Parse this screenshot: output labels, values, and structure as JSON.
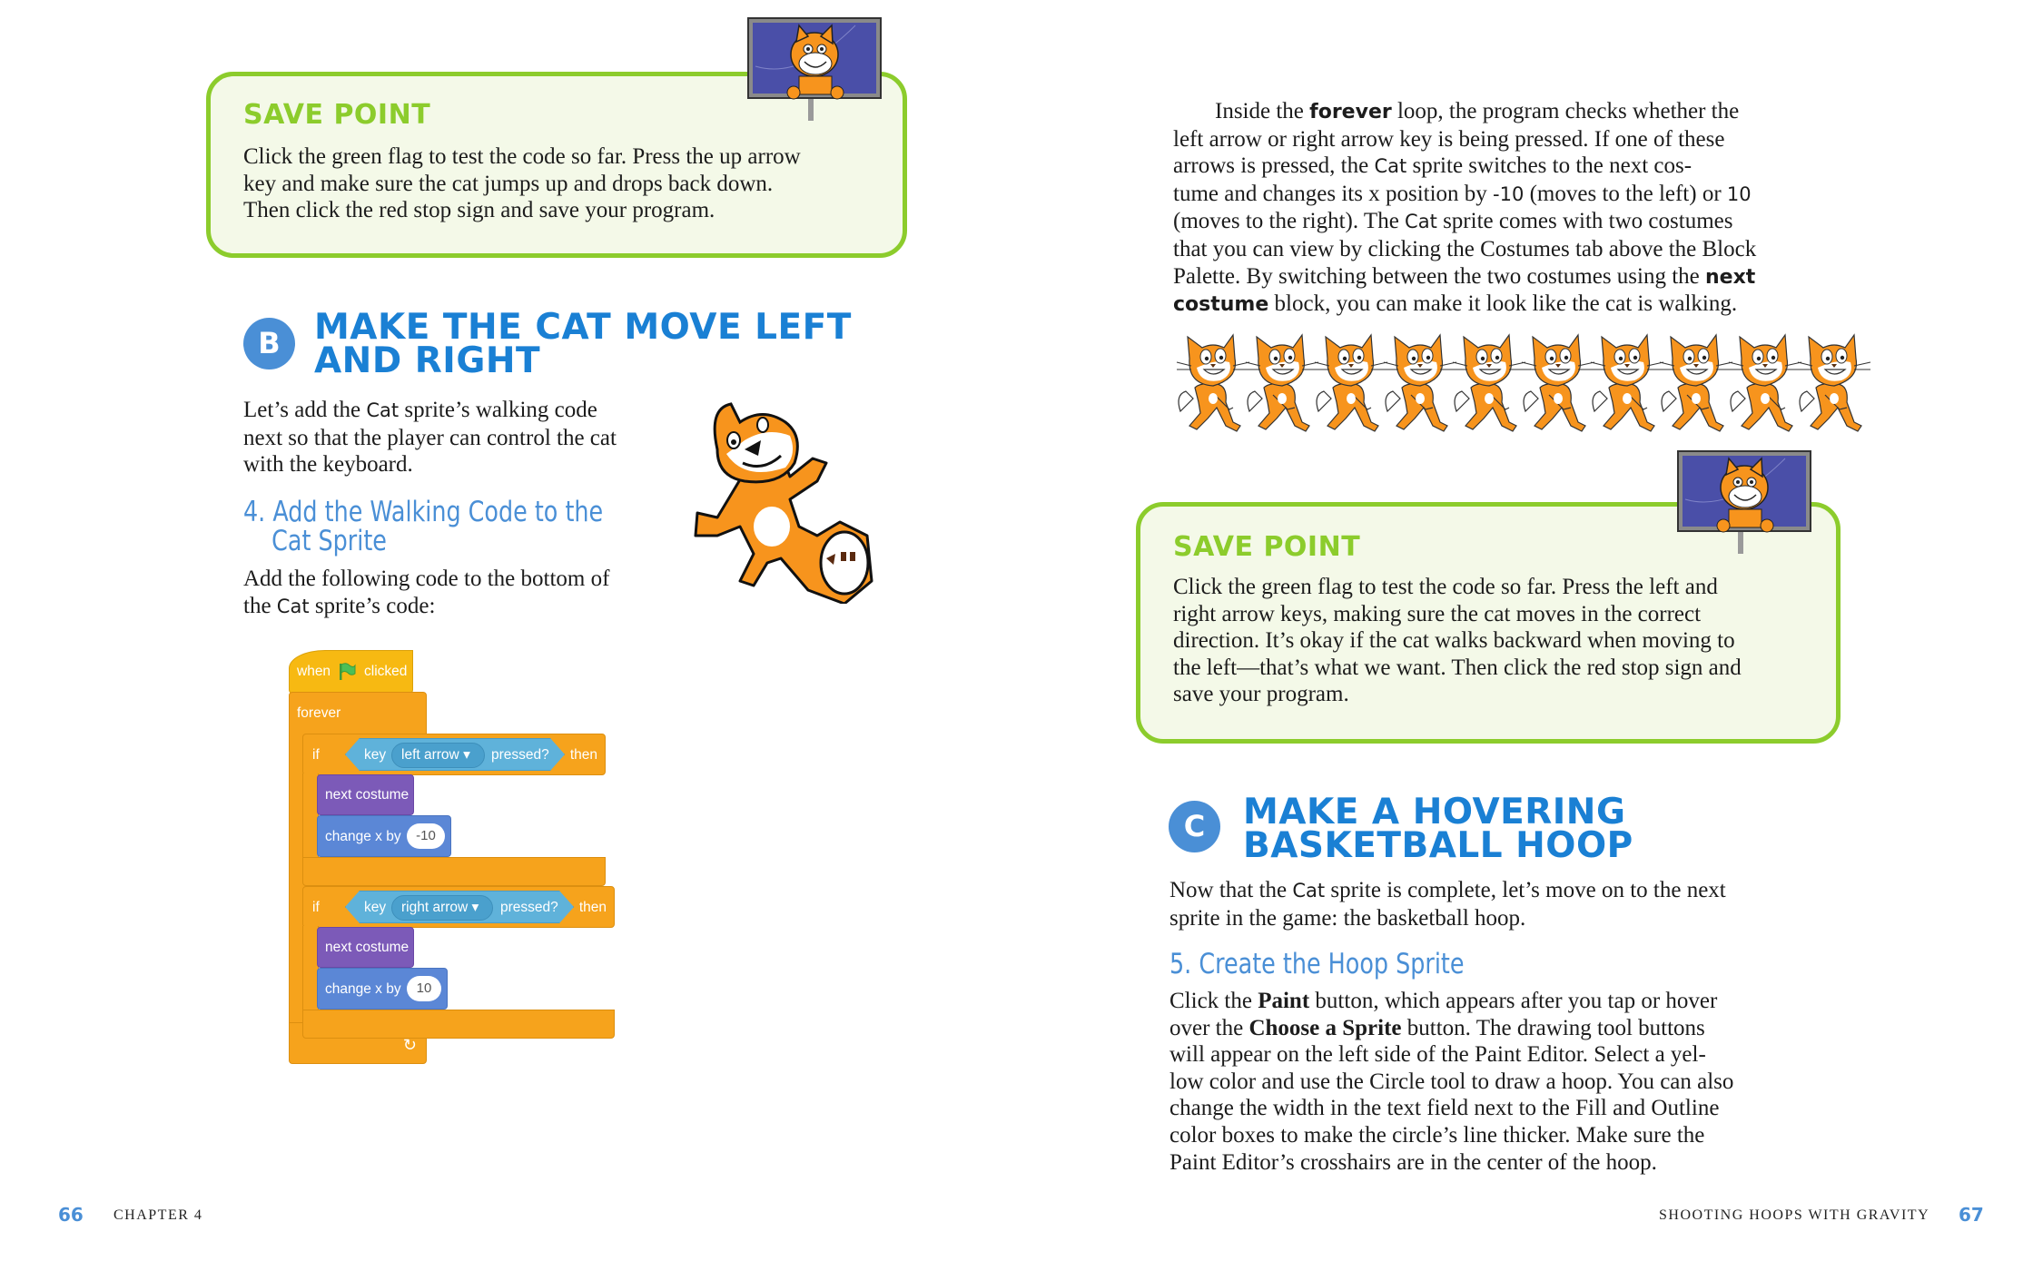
{
  "left_page": {
    "save_point": {
      "title": "SAVE POINT",
      "lines": [
        "Click the green flag to test the code so far. Press the up arrow",
        "key and make sure the cat jumps up and drops back down.",
        "Then click the red stop sign and save your program."
      ]
    },
    "section": {
      "badge": "B",
      "heading_line1": "MAKE THE CAT MOVE LEFT",
      "heading_line2": "AND RIGHT",
      "intro": {
        "l1_pre": "Let’s add the ",
        "l1_code": "Cat",
        "l1_post": " sprite’s walking code",
        "l2": "next so that the player can control the cat",
        "l3": "with the keyboard."
      }
    },
    "step": {
      "line1": "4. Add the Walking Code to the",
      "line2": "Cat Sprite",
      "desc_l1": "Add the following code to the bottom of",
      "desc_l2_pre": "the ",
      "desc_l2_code": "Cat",
      "desc_l2_post": " sprite’s code:"
    },
    "code": {
      "hat_when": "when",
      "hat_clicked": "clicked",
      "forever": "forever",
      "if_blocks": [
        {
          "if": "if",
          "key": "key",
          "option": "left arrow",
          "pressed": "pressed?",
          "then": "then",
          "looks": "next costume",
          "motion": "change x by",
          "value": "-10"
        },
        {
          "if": "if",
          "key": "key",
          "option": "right arrow",
          "pressed": "pressed?",
          "then": "then",
          "looks": "next costume",
          "motion": "change x by",
          "value": "10"
        }
      ],
      "loop_arrow": "↻"
    },
    "footer": {
      "page_number": "66",
      "label": "CHAPTER 4"
    }
  },
  "right_page": {
    "paragraph": {
      "l1_pre": "Inside the ",
      "l1_bold": "forever",
      "l1_post": " loop, the program checks whether the",
      "l2": "left arrow or right arrow key is being pressed. If one of these",
      "l3_pre": "arrows is pressed, the ",
      "l3_code": "Cat",
      "l3_post": " sprite switches to the next cos-",
      "l4_pre": "tume and changes its x position by ",
      "l4_code1": "-10",
      "l4_mid": " (moves to the left) or ",
      "l4_code2": "10",
      "l5_pre": "(moves to the right). The ",
      "l5_code": "Cat",
      "l5_post": " sprite comes with two costumes",
      "l6": "that you can view by clicking the Costumes tab above the Block",
      "l7_pre": "Palette. By switching between the two costumes using the ",
      "l7_bold": "next",
      "l8_bold": "costume",
      "l8_post": " block, you can make it look like the cat is walking."
    },
    "walking_cats_count": 10,
    "save_point": {
      "title": "SAVE POINT",
      "lines": [
        "Click the green flag to test the code so far. Press the left and",
        "right arrow keys, making sure the cat moves in the correct",
        "direction. It’s okay if the cat walks backward when moving to",
        "the left—that’s what we want. Then click the red stop sign and",
        "save your program."
      ]
    },
    "section": {
      "badge": "C",
      "heading_line1": "MAKE A HOVERING",
      "heading_line2": "BASKETBALL HOOP",
      "intro_l1_pre": "Now that the ",
      "intro_l1_code": "Cat",
      "intro_l1_post": " sprite is complete, let’s move on to the next",
      "intro_l2": "sprite in the game: the basketball hoop."
    },
    "step": {
      "title": "5. Create the Hoop Sprite",
      "l1_pre": "Click the ",
      "l1_bold": "Paint",
      "l1_post": " button, which appears after you tap or hover",
      "l2_pre": "over the ",
      "l2_bold": "Choose a Sprite",
      "l2_post": " button. The drawing tool buttons",
      "l3": "will appear on the left side of the Paint Editor. Select a yel-",
      "l4": "low color and use the Circle tool to draw a hoop. You can also",
      "l5": "change the width in the text field next to the Fill and Outline",
      "l6": "color boxes to make the circle’s line thicker. Make sure the",
      "l7": "Paint Editor’s crosshairs are in the center of the hoop."
    },
    "footer": {
      "label": "SHOOTING HOOPS WITH GRAVITY",
      "page_number": "67"
    }
  },
  "colors": {
    "save_green": "#8ccc2c",
    "save_bg": "#f4f9e8",
    "heading_blue": "#1a80d4",
    "accent_blue": "#4a8fd6",
    "events_yellow": "#f7b912",
    "control_orange": "#f6a31c",
    "looks_purple": "#7c5ab8",
    "motion_blue": "#5b87d6",
    "sensing_cyan": "#5fb2da",
    "cat_orange": "#f7941d",
    "tv_screen": "#4a4fa8"
  }
}
